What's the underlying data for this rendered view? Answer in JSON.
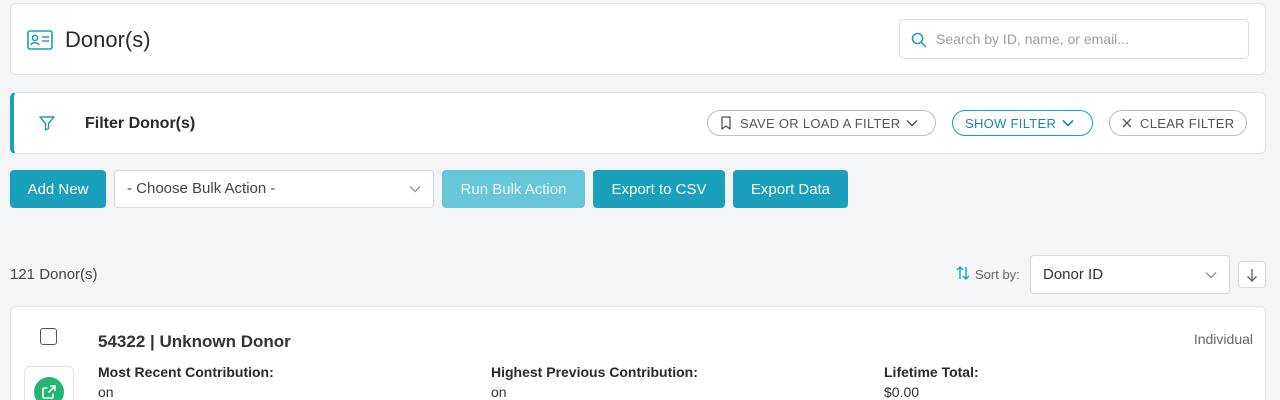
{
  "header": {
    "title": "Donor(s)",
    "search_placeholder": "Search by ID, name, or email..."
  },
  "filter": {
    "title": "Filter Donor(s)",
    "save_load_label": "SAVE OR LOAD A FILTER",
    "show_label": "SHOW FILTER",
    "clear_label": "CLEAR FILTER"
  },
  "toolbar": {
    "add_new_label": "Add New",
    "bulk_action_selected": "- Choose Bulk Action -",
    "run_bulk_label": "Run Bulk Action",
    "export_csv_label": "Export to CSV",
    "export_data_label": "Export Data"
  },
  "list": {
    "count_label": "121 Donor(s)",
    "sort_by_label": "Sort by:",
    "sort_selected": "Donor ID"
  },
  "donors": [
    {
      "title": "54322 | Unknown Donor",
      "type": "Individual",
      "recent_label": "Most Recent Contribution:",
      "recent_value": "on",
      "highest_label": "Highest Previous Contribution:",
      "highest_value": "on",
      "lifetime_label": "Lifetime Total:",
      "lifetime_value": "$0.00"
    }
  ],
  "colors": {
    "accent": "#1a9fbd",
    "accent_disabled": "#67c6d8",
    "success": "#22b573"
  },
  "icons": [
    "id-card-icon",
    "search-icon",
    "funnel-icon",
    "bookmark-icon",
    "chevron-down-icon",
    "close-icon",
    "sort-arrows-icon",
    "arrow-down-icon",
    "external-link-icon"
  ]
}
